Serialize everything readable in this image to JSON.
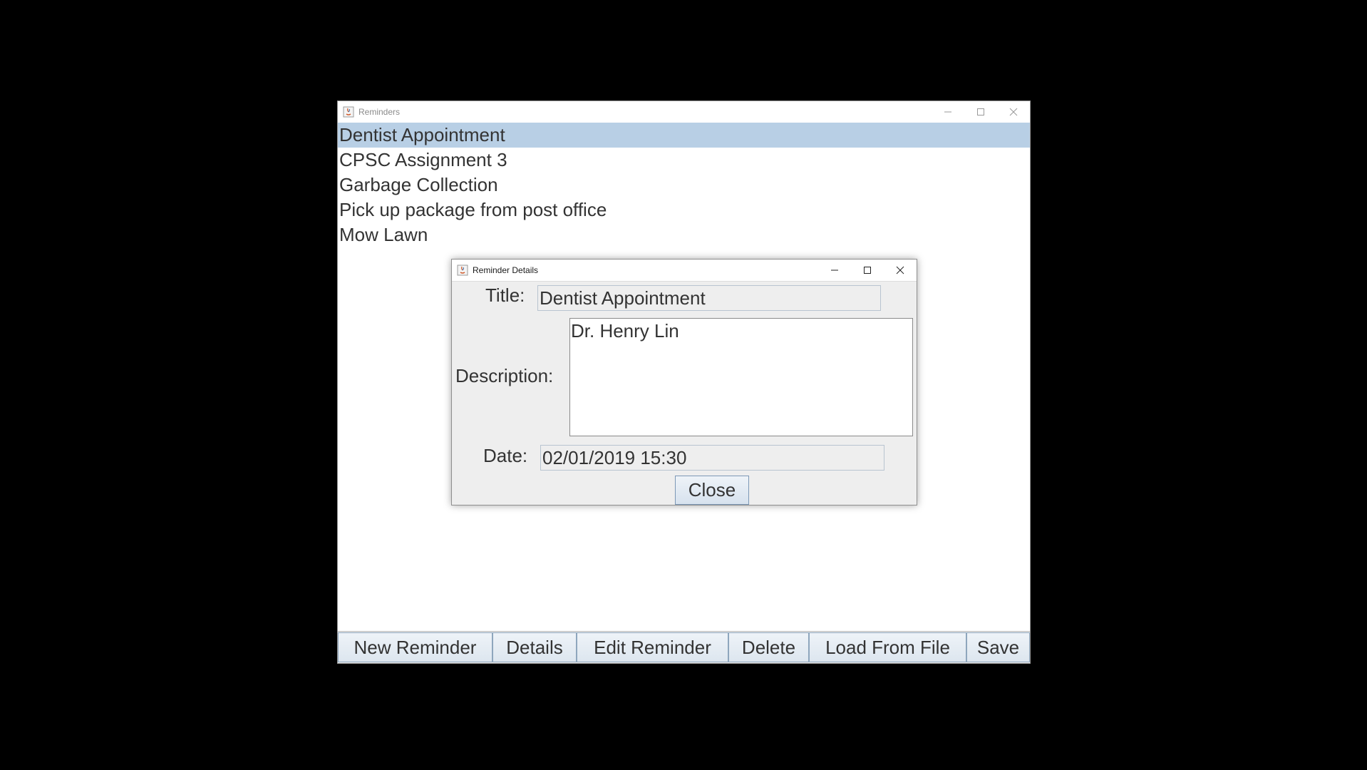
{
  "main_window": {
    "title": "Reminders",
    "icon": "java-app-icon",
    "reminders": [
      "Dentist Appointment",
      "CPSC Assignment 3",
      "Garbage Collection",
      "Pick up package from post office",
      "Mow Lawn"
    ],
    "selected_index": 0,
    "buttons": {
      "new_reminder": "New Reminder",
      "details": "Details",
      "edit_reminder": "Edit Reminder",
      "delete": "Delete",
      "load_from_file": "Load From File",
      "save": "Save"
    }
  },
  "details_dialog": {
    "title": "Reminder Details",
    "icon": "java-app-icon",
    "title_label": "Title:",
    "title_value": "Dentist Appointment",
    "description_label": "Description:",
    "description_value": "Dr. Henry Lin",
    "date_label": "Date:",
    "date_value": "02/01/2019 15:30",
    "close_label": "Close"
  },
  "colors": {
    "selection": "#b8cfe5",
    "button_border": "#8ea6bd",
    "dialog_bg": "#eeeeee",
    "desktop_bg": "#000000"
  }
}
